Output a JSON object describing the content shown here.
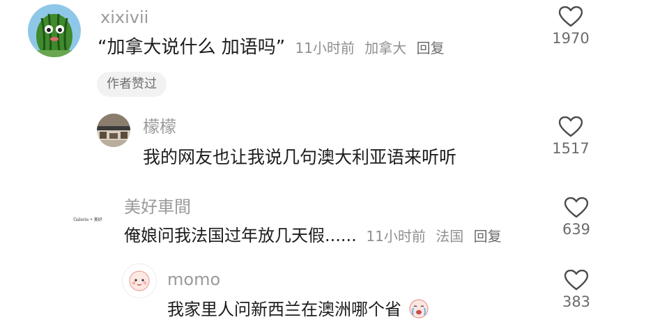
{
  "comments": [
    {
      "username": "xixivii",
      "text": "“加拿大说什么 加语吗”",
      "time": "11小时前",
      "location": "加拿大",
      "reply_label": "回复",
      "likes": "1970",
      "badge": "作者赞过",
      "avatar_icon": "watermelon-avatar-icon"
    },
    {
      "username": "檬檬",
      "text": "我的网友也让我说几句澳大利亚语来听听",
      "likes": "1517",
      "avatar_icon": "photo-avatar-icon"
    },
    {
      "username": "美好車間",
      "text": "俺娘问我法国过年放几天假......",
      "time": "11小时前",
      "location": "法国",
      "reply_label": "回复",
      "likes": "639",
      "avatar_text": "Galerie • 美好",
      "avatar_icon": "logo-avatar-icon"
    },
    {
      "username": "momo",
      "text": "我家里人问新西兰在澳洲哪个省",
      "likes": "383",
      "avatar_icon": "cartoon-avatar-icon",
      "emoji": "crying-face-emoji"
    }
  ],
  "colors": {
    "username": "#9a9a9a",
    "text": "#1c1c1c",
    "meta": "#8f8f8f",
    "badge_bg": "#f2f2f2"
  }
}
